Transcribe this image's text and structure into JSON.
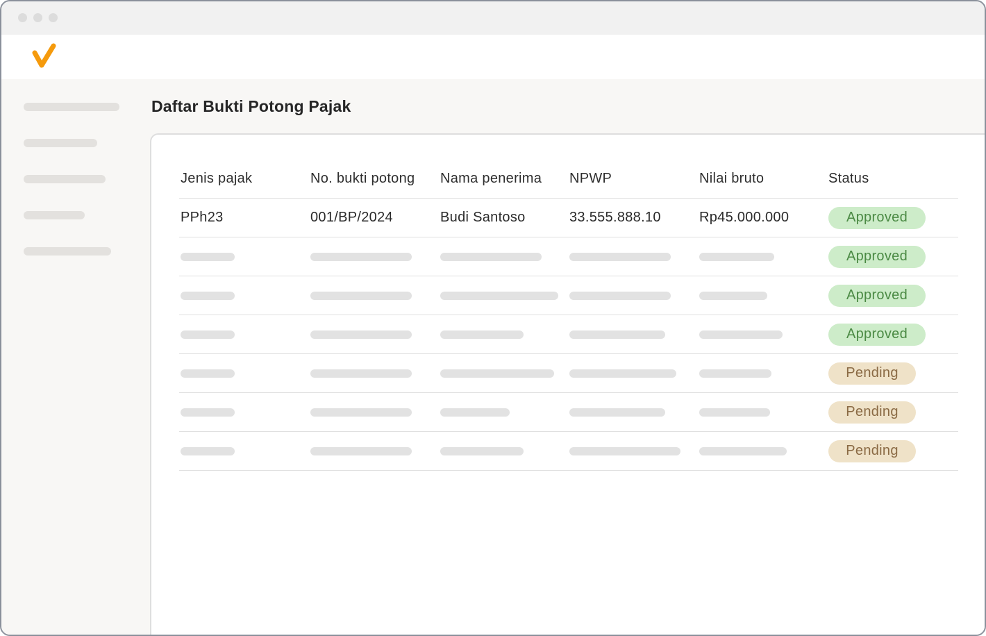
{
  "page": {
    "title": "Daftar Bukti Potong Pajak"
  },
  "colors": {
    "brand": "#f59a0c",
    "approved_bg": "#cdecc9",
    "approved_text": "#4b8a44",
    "pending_bg": "#efe2c8",
    "pending_text": "#8a6a44"
  },
  "icons": {
    "logo": "checkmark-logo"
  },
  "table": {
    "headers": [
      "Jenis pajak",
      "No. bukti potong",
      "Nama penerima",
      "NPWP",
      "Nilai bruto",
      "Status"
    ],
    "first_row": {
      "jenis": "PPh23",
      "nomor": "001/BP/2024",
      "nama": "Budi Santoso",
      "npwp": "33.555.888.10",
      "nilai": "Rp45.000.000",
      "status": "Approved"
    },
    "statuses": [
      "Approved",
      "Approved",
      "Approved",
      "Approved",
      "Pending",
      "Pending",
      "Pending"
    ]
  }
}
